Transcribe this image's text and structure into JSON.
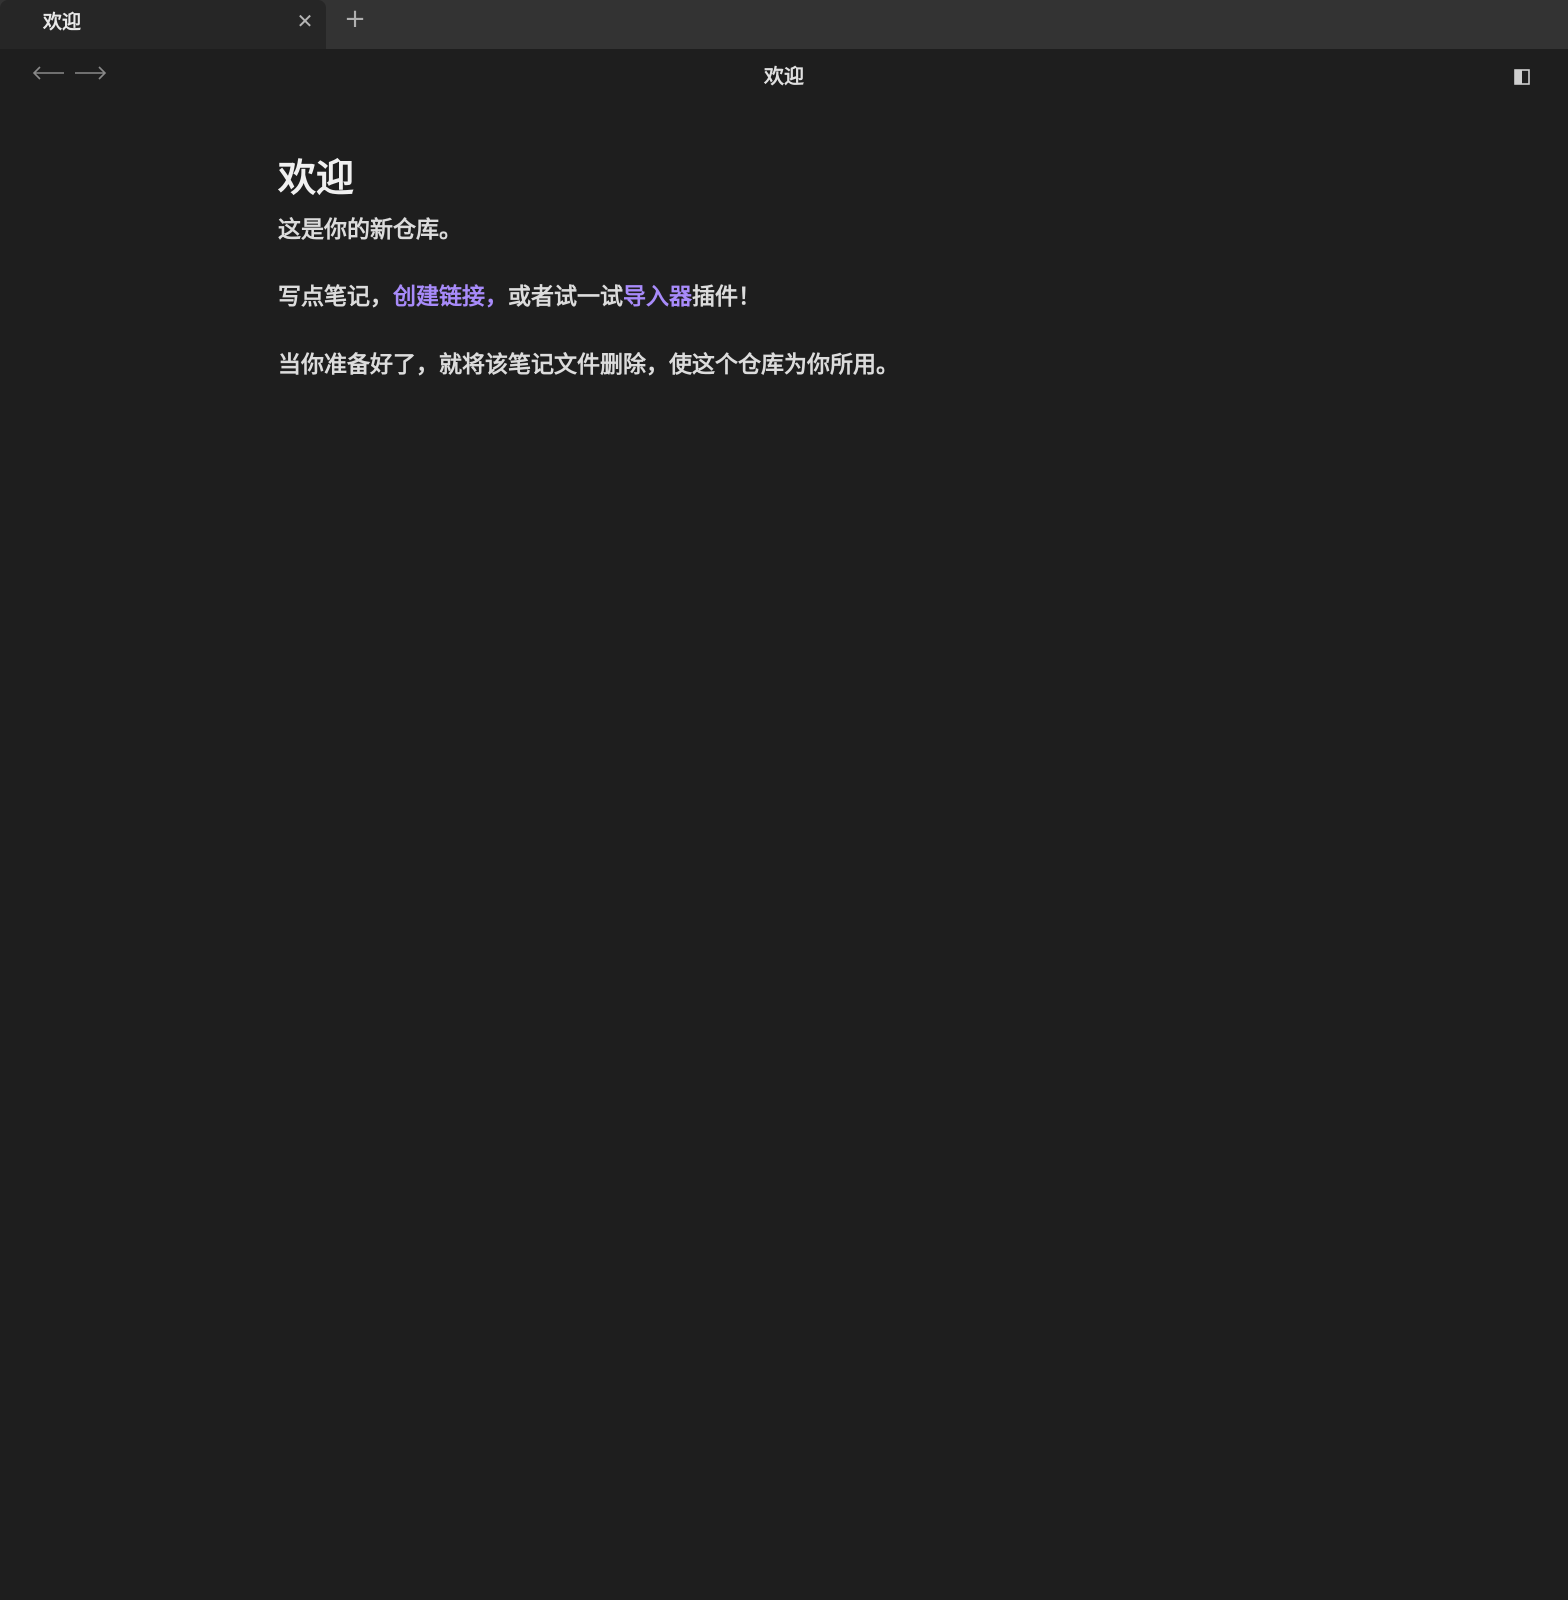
{
  "tab": {
    "title": "欢迎",
    "close_glyph": "✕",
    "new_glyph": "+"
  },
  "header": {
    "title": "欢迎",
    "back_icon": "arrow-left-icon",
    "forward_icon": "arrow-right-icon",
    "sidebar_icon": "sidebar-toggle-icon"
  },
  "note": {
    "title": "欢迎",
    "p1": "这是你的新仓库。",
    "p2_before": "写点笔记，",
    "p2_link1": "创建链接，",
    "p2_middle": "或者试一试",
    "p2_link2": "导入器",
    "p2_after": "插件！",
    "p3": "当你准备好了，就将该笔记文件删除，使这个仓库为你所用。"
  },
  "colors": {
    "background": "#1e1e1e",
    "tabbar": "#333333",
    "tab_active": "#262626",
    "text": "#dcdcdc",
    "link": "#a88bfa"
  }
}
